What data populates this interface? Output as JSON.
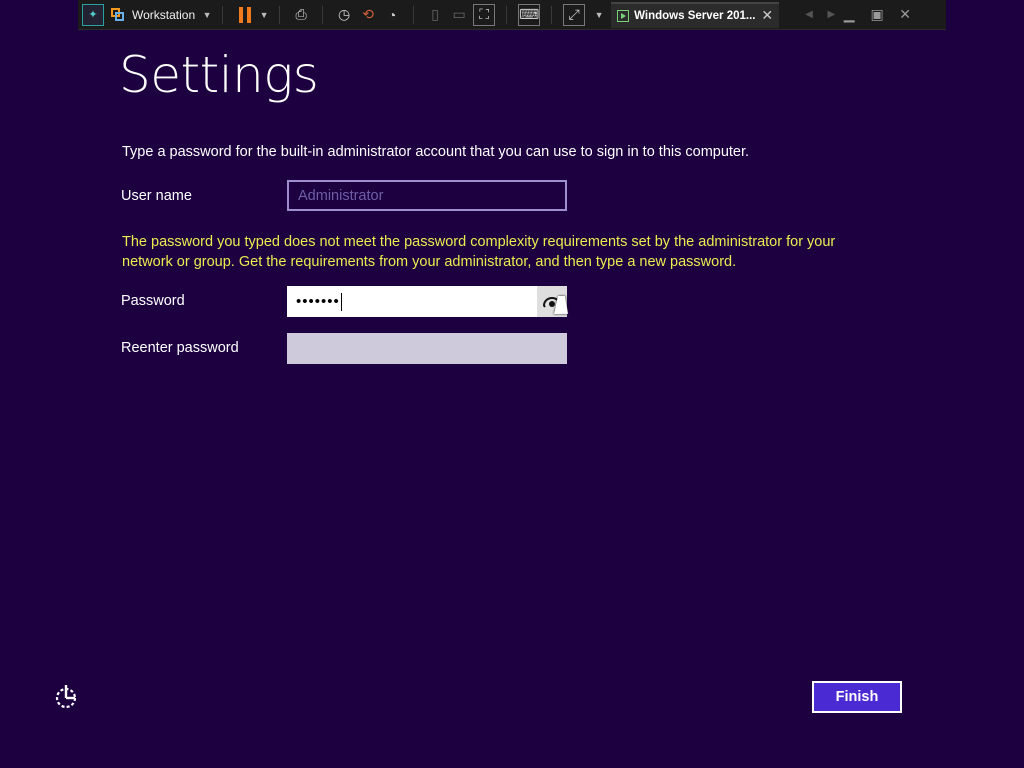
{
  "vm_toolbar": {
    "product_label": "Workstation",
    "tab_label": "Windows Server 201...",
    "icons": [
      "pin-icon",
      "vmware-logo-icon",
      "pause-icon",
      "send-ctrl-alt-del-icon",
      "snapshot-icon",
      "revert-snapshot-icon",
      "snapshot-manager-icon",
      "library-icon",
      "thumbnail-icon",
      "full-screen-icon",
      "console-icon",
      "stretch-icon",
      "close-tab-icon",
      "minimize-icon",
      "restore-icon",
      "close-window-icon"
    ]
  },
  "page": {
    "title": "Settings",
    "description": "Type a password for the built-in administrator account that you can use to sign in to this computer.",
    "username_label": "User name",
    "username_value": "Administrator",
    "warning": "The password you typed does not meet the password complexity requirements set by the administrator for your network or group. Get the requirements from your administrator, and then type a new password.",
    "password_label": "Password",
    "password_value": "•••••••",
    "reenter_label": "Reenter password",
    "reenter_value": "",
    "finish_label": "Finish"
  },
  "colors": {
    "background": "#1c0040",
    "warning_text": "#ecec50",
    "finish_button": "#4a2bd3",
    "vmware_pause": "#f07a1e"
  }
}
